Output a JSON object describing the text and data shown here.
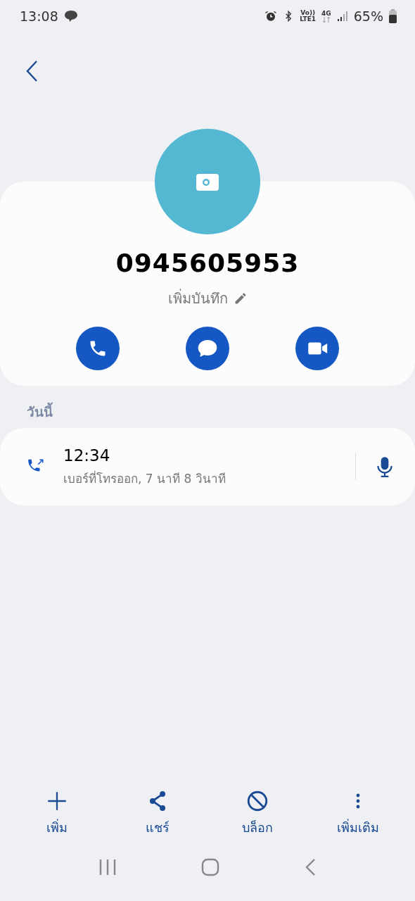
{
  "status_bar": {
    "time": "13:08",
    "volte": "Vo))",
    "lte": "LTE1",
    "network": "4G",
    "battery": "65%"
  },
  "contact": {
    "number": "0945605953",
    "add_note": "เพิ่มบันทึก"
  },
  "actions": [
    {
      "kind": "call"
    },
    {
      "kind": "message"
    },
    {
      "kind": "video"
    }
  ],
  "history": {
    "heading": "วันนี้",
    "calls": [
      {
        "time": "12:34",
        "detail": "เบอร์ที่โทรออก, 7 นาที 8 วินาที"
      }
    ]
  },
  "toolbar": [
    {
      "kind": "add",
      "label": "เพิ่ม"
    },
    {
      "kind": "share",
      "label": "แชร์"
    },
    {
      "kind": "block",
      "label": "บล็อก"
    },
    {
      "kind": "more",
      "label": "เพิ่มเติม"
    }
  ]
}
